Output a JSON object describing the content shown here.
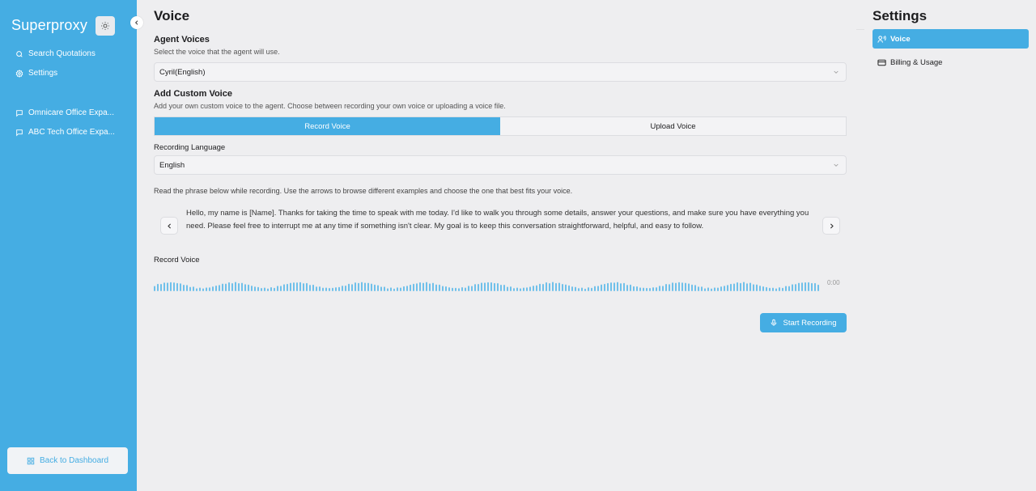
{
  "sidebar": {
    "brand": "Superproxy",
    "theme_icon": "sun-icon",
    "nav": [
      {
        "label": "Search Quotations",
        "icon": "search-icon"
      },
      {
        "label": "Settings",
        "icon": "gear-icon"
      }
    ],
    "chats": [
      {
        "label": "Omnicare Office Expa...",
        "icon": "chat-icon"
      },
      {
        "label": "ABC Tech Office Expa...",
        "icon": "chat-icon"
      }
    ],
    "back_label": "Back to Dashboard"
  },
  "main": {
    "title": "Voice",
    "agent_voices": {
      "title": "Agent Voices",
      "desc": "Select the voice that the agent will use.",
      "selected": "Cyril(English)"
    },
    "custom_voice": {
      "title": "Add Custom Voice",
      "desc": "Add your own custom voice to the agent. Choose between recording your own voice or uploading a voice file.",
      "tabs": [
        "Record Voice",
        "Upload Voice"
      ],
      "active_tab": "Record Voice"
    },
    "recording_language": {
      "label": "Recording Language",
      "selected": "English"
    },
    "instruction": "Read the phrase below while recording. Use the arrows to browse different examples and choose the one that best fits your voice.",
    "phrase": "Hello, my name is [Name]. Thanks for taking the time to speak with me today. I'd like to walk you through some details, answer your questions, and make sure you have everything you need. Please feel free to interrupt me at any time if something isn't clear. My goal is to keep this conversation straightforward, helpful, and easy to follow.",
    "record_label": "Record Voice",
    "time": "0:00",
    "start_button": "Start Recording"
  },
  "settings_panel": {
    "title": "Settings",
    "items": [
      {
        "label": "Voice",
        "icon": "voice-icon",
        "active": true
      },
      {
        "label": "Billing & Usage",
        "icon": "credit-card-icon",
        "active": false
      }
    ]
  },
  "colors": {
    "accent": "#45ade3",
    "background": "#eeeef0",
    "wave": "#6fc0ea"
  }
}
